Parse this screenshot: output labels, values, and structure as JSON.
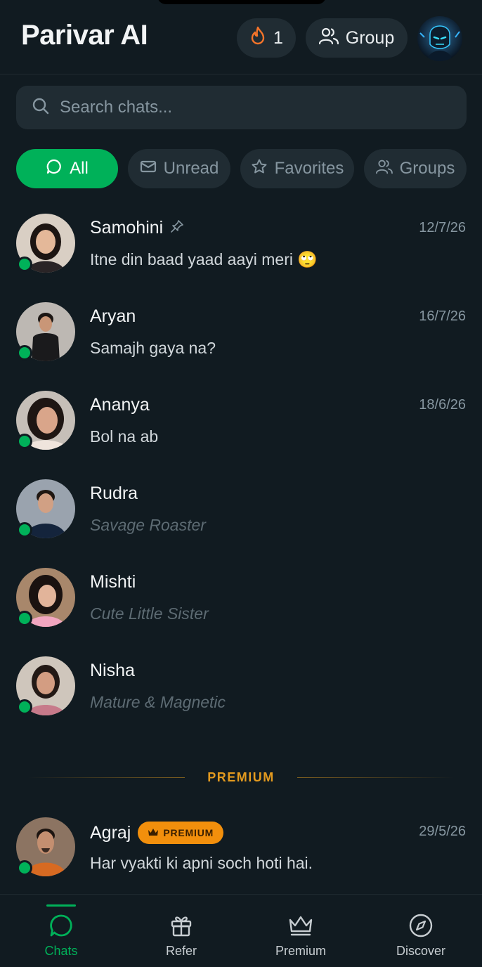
{
  "header": {
    "title": "Parivar AI",
    "streak_icon": "flame-icon",
    "streak_count": "1",
    "group_label": "Group",
    "group_icon": "users-icon",
    "profile_icon": "profile-avatar"
  },
  "search": {
    "placeholder": "Search chats...",
    "icon": "search-icon"
  },
  "filters": [
    {
      "label": "All",
      "icon": "chat-bubble-icon",
      "active": true
    },
    {
      "label": "Unread",
      "icon": "mail-icon",
      "active": false
    },
    {
      "label": "Favorites",
      "icon": "star-icon",
      "active": false
    },
    {
      "label": "Groups",
      "icon": "users-icon",
      "active": false
    }
  ],
  "chats": [
    {
      "name": "Samohini",
      "pinned": true,
      "date": "12/7/26",
      "message": "Itne din baad yaad aayi meri 🙄",
      "online": true
    },
    {
      "name": "Aryan",
      "pinned": false,
      "date": "16/7/26",
      "message": "Samajh gaya na?",
      "online": true
    },
    {
      "name": "Ananya",
      "pinned": false,
      "date": "18/6/26",
      "message": "Bol na ab",
      "online": true
    },
    {
      "name": "Rudra",
      "pinned": false,
      "date": "",
      "message": "Savage Roaster",
      "online": true
    },
    {
      "name": "Mishti",
      "pinned": false,
      "date": "",
      "message": "Cute Little Sister",
      "online": true
    },
    {
      "name": "Nisha",
      "pinned": false,
      "date": "",
      "message": "Mature & Magnetic",
      "online": true
    }
  ],
  "premium_section": {
    "divider_label": "PREMIUM",
    "chat": {
      "name": "Agraj",
      "badge": "PREMIUM",
      "badge_icon": "crown-icon",
      "date": "29/5/26",
      "message": "Har vyakti ki apni soch hoti hai.",
      "online": true
    }
  },
  "nav": [
    {
      "label": "Chats",
      "icon": "chat-bubble-icon",
      "active": true
    },
    {
      "label": "Refer",
      "icon": "gift-icon",
      "active": false
    },
    {
      "label": "Premium",
      "icon": "crown-icon",
      "active": false
    },
    {
      "label": "Discover",
      "icon": "compass-icon",
      "active": false
    }
  ],
  "colors": {
    "background": "#111b21",
    "surface": "#202c33",
    "accent": "#00b159",
    "premium": "#f28f0c",
    "muted_text": "#8696a0"
  }
}
